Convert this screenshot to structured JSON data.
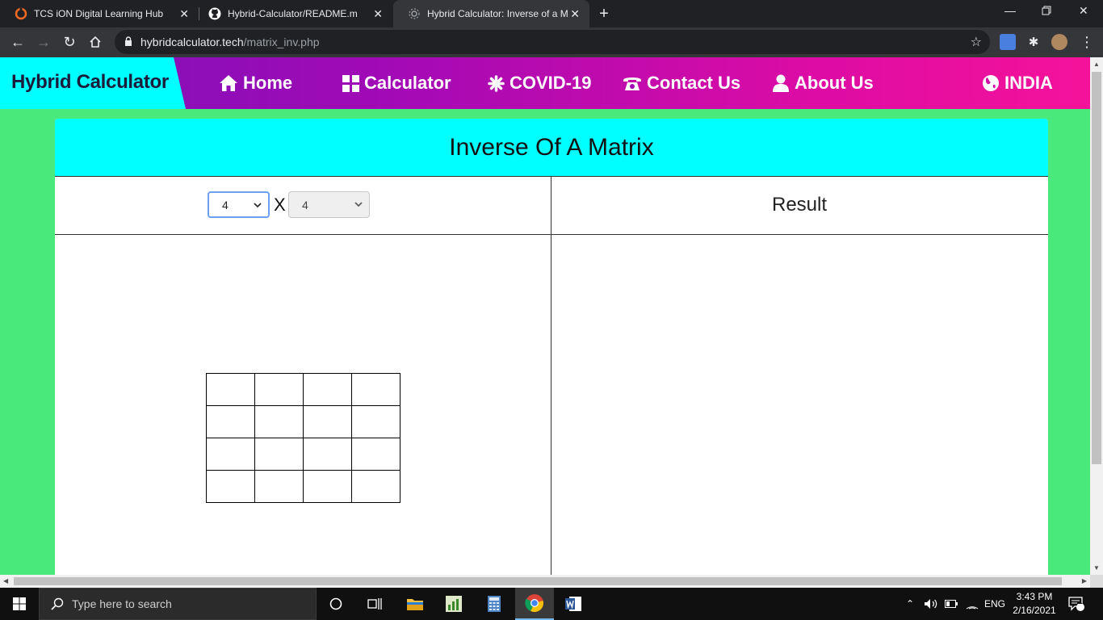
{
  "browser": {
    "tabs": [
      {
        "title": "TCS iON Digital Learning Hub",
        "close": "✕"
      },
      {
        "title": "Hybrid-Calculator/README.md a",
        "close": "✕"
      },
      {
        "title": "Hybrid Calculator: Inverse of a M",
        "close": "✕"
      }
    ],
    "new_tab": "+",
    "url_host": "hybridcalculator.tech",
    "url_path": "/matrix_inv.php"
  },
  "site": {
    "brand": "Hybrid Calculator",
    "nav": [
      {
        "label": "Home",
        "icon": "home-icon"
      },
      {
        "label": "Calculator",
        "icon": "grid-icon"
      },
      {
        "label": "COVID-19",
        "icon": "asterisk-icon"
      },
      {
        "label": "Contact Us",
        "icon": "phone-icon"
      },
      {
        "label": "About Us",
        "icon": "user-icon"
      },
      {
        "label": "INDIA",
        "icon": "globe-icon"
      }
    ],
    "accent_colors": {
      "brand_bg": "#00ffff",
      "nav_gradient_start": "#7a12b8",
      "nav_gradient_end": "#f5129a",
      "page_bg": "#49e97c"
    }
  },
  "main": {
    "title": "Inverse Of A Matrix",
    "rows_value": "4",
    "cols_value": "4",
    "times_symbol": "X",
    "result_label": "Result",
    "matrix": {
      "rows": 4,
      "cols": 4,
      "cells": [
        "",
        "",
        "",
        "",
        "",
        "",
        "",
        "",
        "",
        "",
        "",
        "",
        "",
        "",
        "",
        ""
      ]
    }
  },
  "taskbar": {
    "search_placeholder": "Type here to search",
    "language": "ENG",
    "time": "3:43 PM",
    "date": "2/16/2021",
    "notification_count": "1"
  }
}
